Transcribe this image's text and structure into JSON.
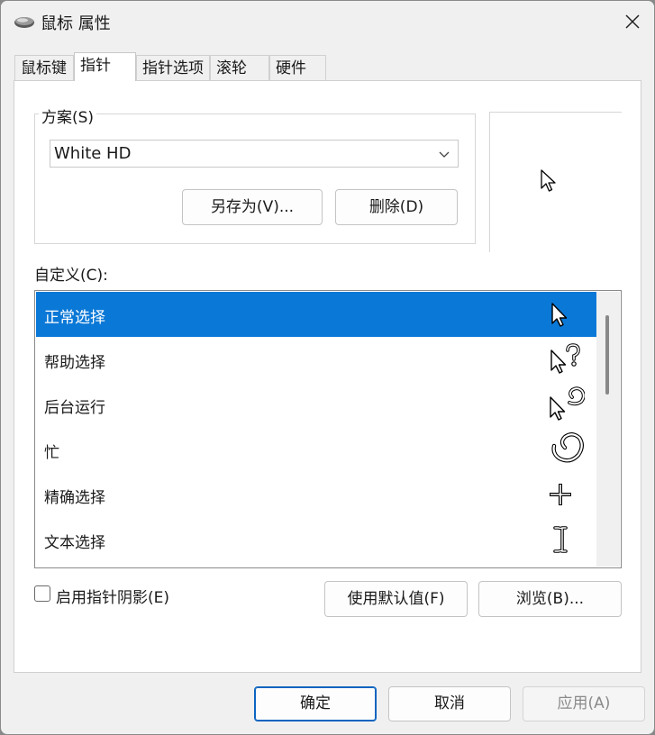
{
  "window": {
    "title": "鼠标 属性"
  },
  "tabs": [
    {
      "label": "鼠标键"
    },
    {
      "label": "指针"
    },
    {
      "label": "指针选项"
    },
    {
      "label": "滚轮"
    },
    {
      "label": "硬件"
    }
  ],
  "scheme": {
    "legend": "方案(S)",
    "selected": "White HD",
    "save_as_label": "另存为(V)...",
    "delete_label": "删除(D)"
  },
  "customize": {
    "label": "自定义(C):",
    "items": [
      {
        "label": "正常选择",
        "cursor_icon": "arrow-cursor-icon",
        "selected": true
      },
      {
        "label": "帮助选择",
        "cursor_icon": "help-cursor-icon",
        "selected": false
      },
      {
        "label": "后台运行",
        "cursor_icon": "working-in-background-cursor-icon",
        "selected": false
      },
      {
        "label": "忙",
        "cursor_icon": "busy-cursor-icon",
        "selected": false
      },
      {
        "label": "精确选择",
        "cursor_icon": "crosshair-cursor-icon",
        "selected": false
      },
      {
        "label": "文本选择",
        "cursor_icon": "text-beam-cursor-icon",
        "selected": false
      }
    ]
  },
  "options": {
    "shadow_label": "启用指针阴影(E)",
    "shadow_checked": false,
    "use_default_label": "使用默认值(F)",
    "browse_label": "浏览(B)..."
  },
  "footer": {
    "ok_label": "确定",
    "cancel_label": "取消",
    "apply_label": "应用(A)",
    "apply_enabled": false
  },
  "colors": {
    "selection": "#0a78d7",
    "ok_border": "#0a64c0",
    "disabled_text": "#8a8a8a"
  }
}
